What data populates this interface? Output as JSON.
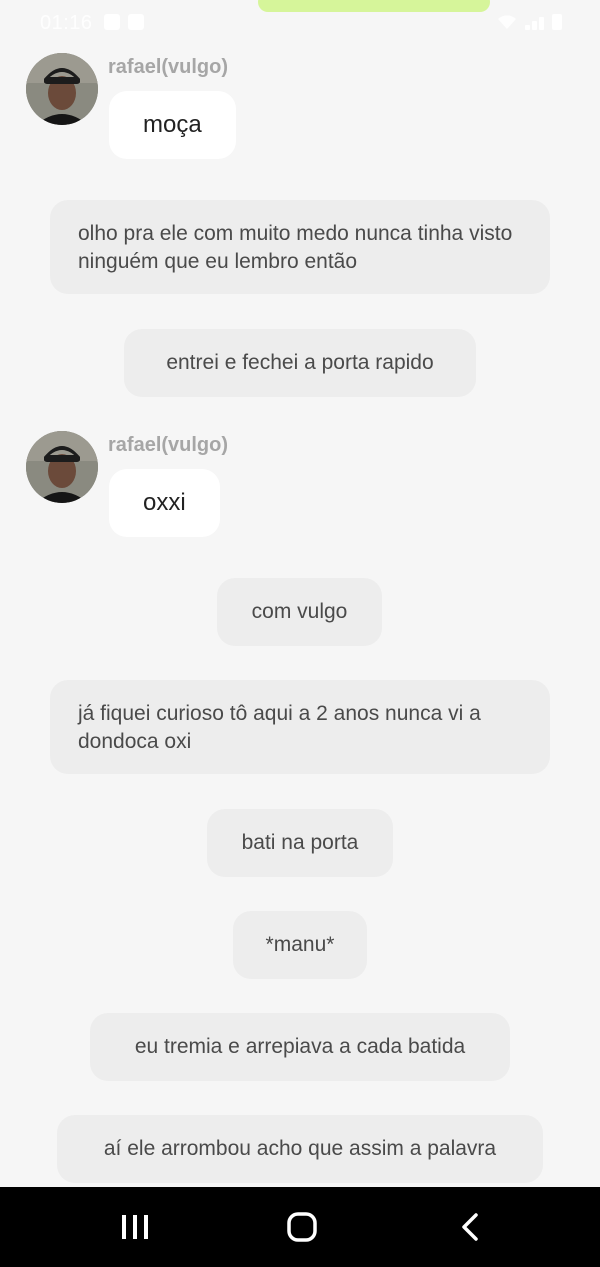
{
  "status_bar": {
    "time": "01:16"
  },
  "messages": [
    {
      "kind": "character",
      "sender": "rafael(vulgo)",
      "text": "moça"
    },
    {
      "kind": "narration",
      "text": "olho pra ele com muito medo nunca tinha visto ninguém que eu lembro então"
    },
    {
      "kind": "narration",
      "text": "entrei e fechei a porta rapido"
    },
    {
      "kind": "character",
      "sender": "rafael(vulgo)",
      "text": "oxxi"
    },
    {
      "kind": "narration",
      "text": "com vulgo"
    },
    {
      "kind": "narration",
      "text": "já fiquei curioso tô aqui a 2 anos nunca vi a dondoca oxi"
    },
    {
      "kind": "narration",
      "text": "bati na porta"
    },
    {
      "kind": "narration",
      "text": "*manu*"
    },
    {
      "kind": "narration",
      "text": "eu tremia e arrepiava a cada batida"
    },
    {
      "kind": "narration",
      "text": "aí ele arrombou acho que assim a palavra"
    }
  ],
  "nav": {
    "recents_icon": "recents-icon",
    "home_icon": "home-icon",
    "back_icon": "back-icon"
  },
  "colors": {
    "accent_pill": "#d6f59a",
    "background": "#f6f6f6",
    "narration_bubble": "#ededed"
  }
}
